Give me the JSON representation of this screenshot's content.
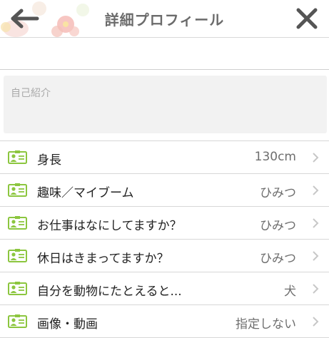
{
  "header": {
    "title": "詳細プロフィール",
    "back_icon": "arrow-left-icon",
    "close_icon": "close-x-icon",
    "decoration": "floral-decoration"
  },
  "intro": {
    "placeholder": "自己紹介"
  },
  "rows": [
    {
      "label": "身長",
      "value": "130cm"
    },
    {
      "label": "趣味／マイブーム",
      "value": "ひみつ"
    },
    {
      "label": "お仕事はなにしてますか？",
      "value": "ひみつ"
    },
    {
      "label": "休日はきまってますか？",
      "value": "ひみつ"
    },
    {
      "label": "自分を動物にたとえると...",
      "value": "犬"
    },
    {
      "label": "画像・動画",
      "value": "指定しない"
    }
  ],
  "colors": {
    "accent_green": "#8cc63f",
    "chevron": "#c7c7c7",
    "icon_dark": "#555555"
  }
}
